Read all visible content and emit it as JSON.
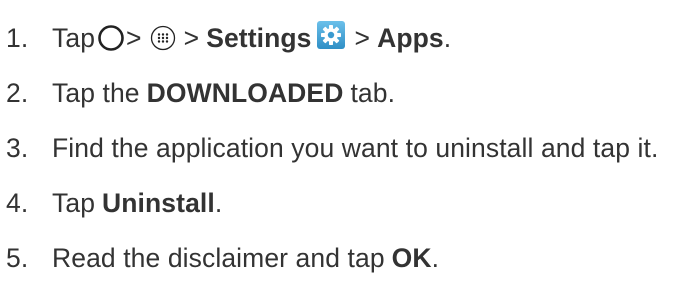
{
  "steps": [
    {
      "number": "1.",
      "parts": {
        "tap": "Tap",
        "gt1": ">",
        "gt2": ">",
        "settings": "Settings",
        "gt3": ">",
        "apps": "Apps",
        "period": "."
      },
      "icons": [
        "home-circle-icon",
        "all-apps-icon",
        "settings-gear-icon"
      ]
    },
    {
      "number": "2.",
      "parts": {
        "pre": "Tap the",
        "bold": "DOWNLOADED",
        "post": "tab."
      }
    },
    {
      "number": "3.",
      "parts": {
        "text": "Find the application you want to uninstall and tap it."
      }
    },
    {
      "number": "4.",
      "parts": {
        "pre": "Tap",
        "bold": "Uninstall",
        "post": "."
      }
    },
    {
      "number": "5.",
      "parts": {
        "pre": "Read the disclaimer and tap",
        "bold": "OK",
        "post": "."
      }
    }
  ],
  "colors": {
    "text": "#333333",
    "settings_icon_bg": "#4aa8d8",
    "settings_icon_fg": "#ffffff"
  }
}
